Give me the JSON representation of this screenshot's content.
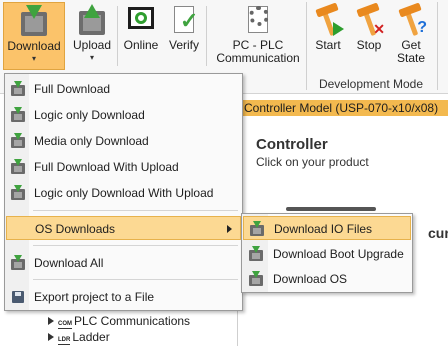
{
  "ribbon": {
    "download_label": "Download",
    "upload_label": "Upload",
    "online_label": "Online",
    "verify_label": "Verify",
    "pc_plc_line1": "PC - PLC",
    "pc_plc_line2": "Communication",
    "start_label": "Start",
    "stop_label": "Stop",
    "get_state_line1": "Get",
    "get_state_line2": "State",
    "group_label": "Development Mode"
  },
  "download_menu": {
    "items": [
      {
        "label": "Full Download",
        "icon": "board-download-icon"
      },
      {
        "label": "Logic only Download",
        "icon": "board-download-icon"
      },
      {
        "label": "Media only Download",
        "icon": "board-download-icon"
      },
      {
        "label": "Full Download With Upload",
        "icon": "board-download-icon"
      },
      {
        "label": "Logic only Download With Upload",
        "icon": "board-download-icon"
      },
      {
        "label": "OS Downloads",
        "icon": "none",
        "has_submenu": true
      },
      {
        "label": "Download All",
        "icon": "board-download-icon"
      },
      {
        "label": "Export project to a File",
        "icon": "floppy-disk-icon"
      }
    ],
    "highlighted": "OS Downloads"
  },
  "os_submenu": {
    "items": [
      {
        "label": "Download IO Files",
        "icon": "board-download-icon"
      },
      {
        "label": "Download Boot Upgrade",
        "icon": "board-download-icon"
      },
      {
        "label": "Download OS",
        "icon": "board-download-icon"
      }
    ],
    "highlighted": "Download IO Files"
  },
  "main": {
    "controller_model_header": "Controller Model (USP-070-x10/x08)",
    "controller_title": "Controller",
    "controller_subtitle": "Click on your product",
    "partial_text": "curr"
  },
  "tree": {
    "items": [
      {
        "tag": "COM",
        "label": "PLC Communications"
      },
      {
        "tag": "LDR",
        "label": "Ladder"
      }
    ]
  },
  "colors": {
    "highlight": "#fcd993",
    "active_button": "#fbc36a",
    "header_bar": "#f3b94f"
  }
}
